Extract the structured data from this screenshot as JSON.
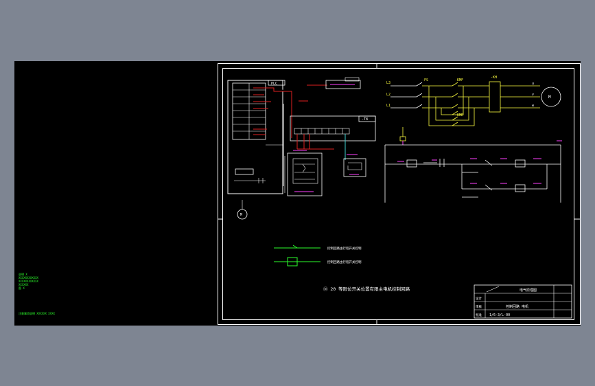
{
  "colors": {
    "background": "#7e8592",
    "canvas": "#000000",
    "lines": "#ffffff",
    "red": "#e02020",
    "yellow": "#ffff40",
    "magenta": "#ff40ff",
    "green": "#2cff2c",
    "cyan": "#40d0d0"
  },
  "drawing": {
    "main_caption": "ⓦ 20 等限位开关位置有限主电机控制回路",
    "power_labels": [
      "L3",
      "L2",
      "L1"
    ],
    "fuse_label": "-FS",
    "contactor_forward": "-KMF",
    "contactor_reverse": "-KMR",
    "thermal_relay": "-KH",
    "motor_label": "M",
    "motor_phases": [
      "u",
      "v",
      "w"
    ],
    "plc_box_label": "PLC",
    "relay_block_label": "-T8",
    "small_motor_label": "M",
    "legend_line1": "控制回路由行程开关控制",
    "legend_line2": "控制回路由行程开关控制"
  },
  "title_block": {
    "title": "电气原理图",
    "drawing_no": "1/6-3/L-00",
    "row1": "设计",
    "row2": "审核",
    "row3": "批准",
    "name": "控制回路 电机"
  },
  "left_notes": {
    "lines": [
      "说明 X",
      "XXXXXXXXXXXX",
      "XXXXXXXXXXXX",
      "XXXXXX",
      "图 X"
    ],
    "footer": "注意事项说明 XXXXXX XXXX"
  }
}
